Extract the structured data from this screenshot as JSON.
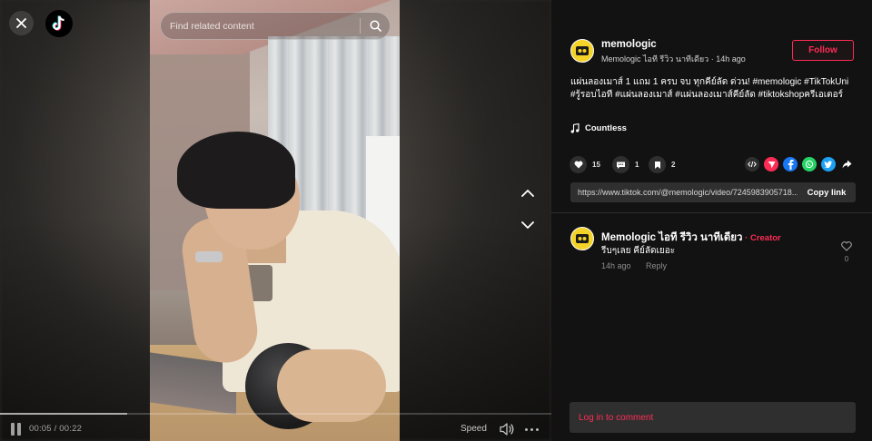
{
  "search": {
    "placeholder": "Find related content"
  },
  "player": {
    "time": "00:05 / 00:22",
    "speed_label": "Speed",
    "progress": 0.23
  },
  "author": {
    "username": "memologic",
    "display_name": "Memologic ไอที รีวิว นาทีเดียว",
    "posted": "14h ago",
    "meta": "Memologic ไอที รีวิว นาทีเดียว · 14h ago",
    "follow_label": "Follow"
  },
  "post": {
    "caption": "แผ่นลองเมาส์ 1 แถม 1 ครบ จบ ทุกคีย์ลัด ด่วน! #memologic #TikTokUni #รู้รอบไอที #แผ่นลองเมาส์ #แผ่นลองเมาส์คีย์ลัด #tiktokshopครีเอเตอร์",
    "music": "Countless",
    "likes": "15",
    "comments": "1",
    "saves": "2",
    "link": "https://www.tiktok.com/@memologic/video/7245983905718...",
    "copy_link_label": "Copy link"
  },
  "comment": {
    "author": "Memologic ไอที รีวิว นาทีเดียว",
    "creator_tag": " · Creator",
    "text": "รีบๆเลย คีย์ลัดเยอะ",
    "time": "14h ago",
    "reply_label": "Reply",
    "likes": "0"
  },
  "login": {
    "label": "Log in to comment"
  },
  "colors": {
    "accent": "#fe2c55",
    "panel_bg": "#121212",
    "input_bg": "#2f2f2f"
  },
  "icons": [
    "close-icon",
    "tiktok-logo-icon",
    "search-icon",
    "chevron-up-icon",
    "chevron-down-icon",
    "pause-icon",
    "volume-icon",
    "more-icon",
    "heart-icon",
    "comment-icon",
    "bookmark-icon",
    "music-note-icon",
    "embed-icon",
    "send-icon",
    "facebook-icon",
    "whatsapp-icon",
    "twitter-icon",
    "share-arrow-icon"
  ]
}
